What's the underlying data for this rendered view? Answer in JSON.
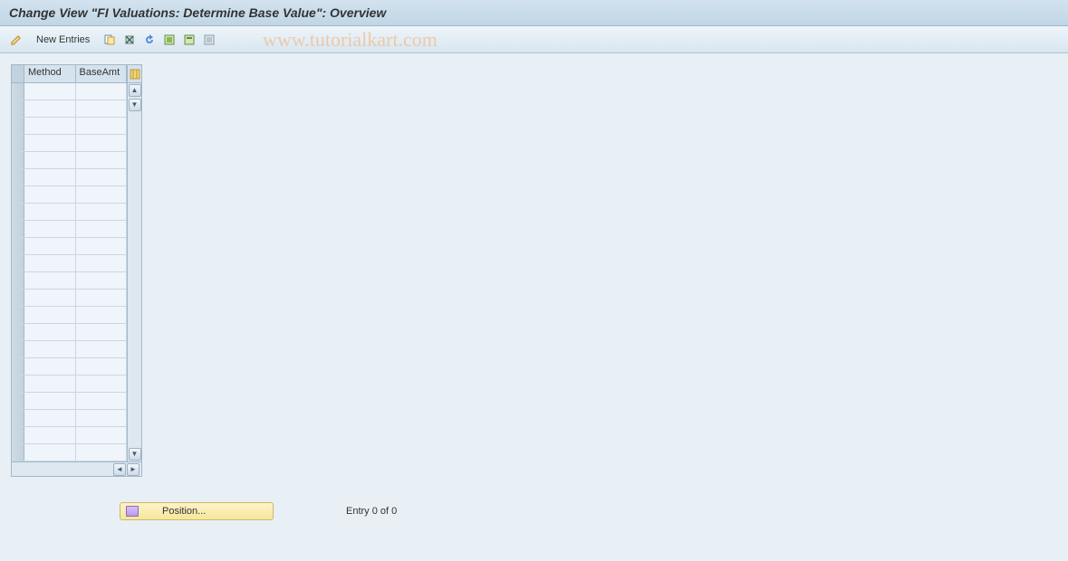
{
  "title": "Change View \"FI Valuations: Determine Base Value\": Overview",
  "toolbar": {
    "new_entries": "New Entries"
  },
  "watermark": "www.tutorialkart.com",
  "table": {
    "col1": "Method",
    "col2": "BaseAmt",
    "row_count": 22
  },
  "footer": {
    "position_label": "Position...",
    "entry_text": "Entry 0 of 0"
  }
}
